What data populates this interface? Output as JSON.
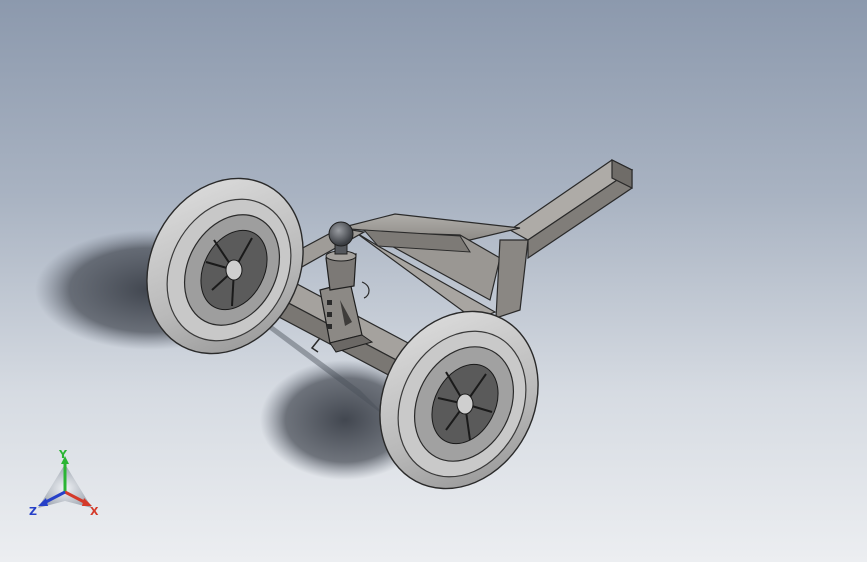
{
  "viewport": {
    "background_top": "#8c99ad",
    "background_bottom": "#eceef1"
  },
  "model": {
    "description_icon": "trailer-dolly-model",
    "parts": [
      "left-wheel",
      "right-wheel",
      "axle",
      "frame",
      "tongue",
      "ball-hitch",
      "jack-stand"
    ]
  },
  "triad": {
    "x_label": "X",
    "y_label": "Y",
    "z_label": "Z",
    "x_color": "#d43a2a",
    "y_color": "#2bb534",
    "z_color": "#2640c8"
  }
}
